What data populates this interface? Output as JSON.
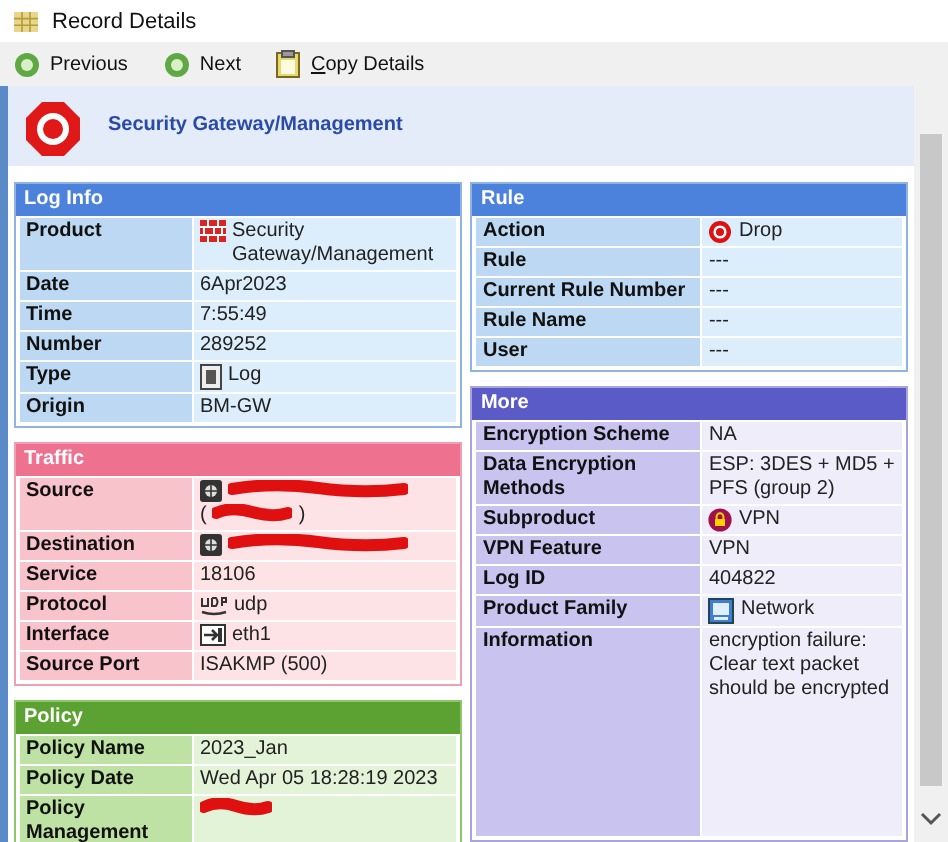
{
  "window": {
    "title": "Record Details"
  },
  "toolbar": [
    {
      "label": "Previous",
      "kind": "prev",
      "underline_first": false
    },
    {
      "label": "Next",
      "kind": "next",
      "underline_first": false
    },
    {
      "label": "Copy Details",
      "kind": "copy",
      "underline_first": true
    }
  ],
  "header": {
    "title": "Security Gateway/Management"
  },
  "columns": [
    {
      "panels": [
        {
          "title": "Log Info",
          "kind": "info",
          "rows": [
            {
              "label": "Product",
              "value": "Security Gateway/Management",
              "kind": "firewall"
            },
            {
              "label": "Date",
              "value": "6Apr2023"
            },
            {
              "label": "Time",
              "value": "7:55:49"
            },
            {
              "label": "Number",
              "value": "289252"
            },
            {
              "label": "Type",
              "value": "Log",
              "kind": "log"
            },
            {
              "label": "Origin",
              "value": "BM-GW"
            }
          ]
        },
        {
          "title": "Traffic",
          "kind": "traffic",
          "rows": [
            {
              "label": "Source",
              "kind": "host",
              "redacted": true,
              "value_parts": [
                "(",
                ")"
              ]
            },
            {
              "label": "Destination",
              "kind": "host",
              "redacted": true
            },
            {
              "label": "Service",
              "value": "18106"
            },
            {
              "label": "Protocol",
              "value": "udp",
              "kind": "udp"
            },
            {
              "label": "Interface",
              "value": "eth1",
              "kind": "interface"
            },
            {
              "label": "Source Port",
              "value": "ISAKMP (500)"
            }
          ]
        },
        {
          "title": "Policy",
          "kind": "policy",
          "rows": [
            {
              "label": "Policy Name",
              "value": "2023_Jan"
            },
            {
              "label": "Policy Date",
              "value": "Wed Apr 05 18:28:19 2023"
            },
            {
              "label": "Policy Management",
              "redacted": true
            }
          ]
        }
      ]
    },
    {
      "panels": [
        {
          "title": "Rule",
          "kind": "rule",
          "rows": [
            {
              "label": "Action",
              "value": "Drop",
              "kind": "drop"
            },
            {
              "label": "Rule",
              "value": "---"
            },
            {
              "label": "Current Rule Number",
              "value": "---"
            },
            {
              "label": "Rule Name",
              "value": "---"
            },
            {
              "label": "User",
              "value": "---"
            }
          ]
        },
        {
          "title": "More",
          "kind": "more",
          "rows": [
            {
              "label": "Encryption Scheme",
              "value": "NA"
            },
            {
              "label": "Data Encryption Methods",
              "value": "ESP: 3DES + MD5 + PFS (group 2)"
            },
            {
              "label": "Subproduct",
              "value": "VPN",
              "kind": "lock"
            },
            {
              "label": "VPN Feature",
              "value": "VPN"
            },
            {
              "label": "Log ID",
              "value": "404822"
            },
            {
              "label": "Product Family",
              "value": "Network",
              "kind": "network"
            },
            {
              "label": "Information",
              "value": "encryption failure: Clear text packet should be encrypted"
            }
          ]
        }
      ]
    }
  ]
}
